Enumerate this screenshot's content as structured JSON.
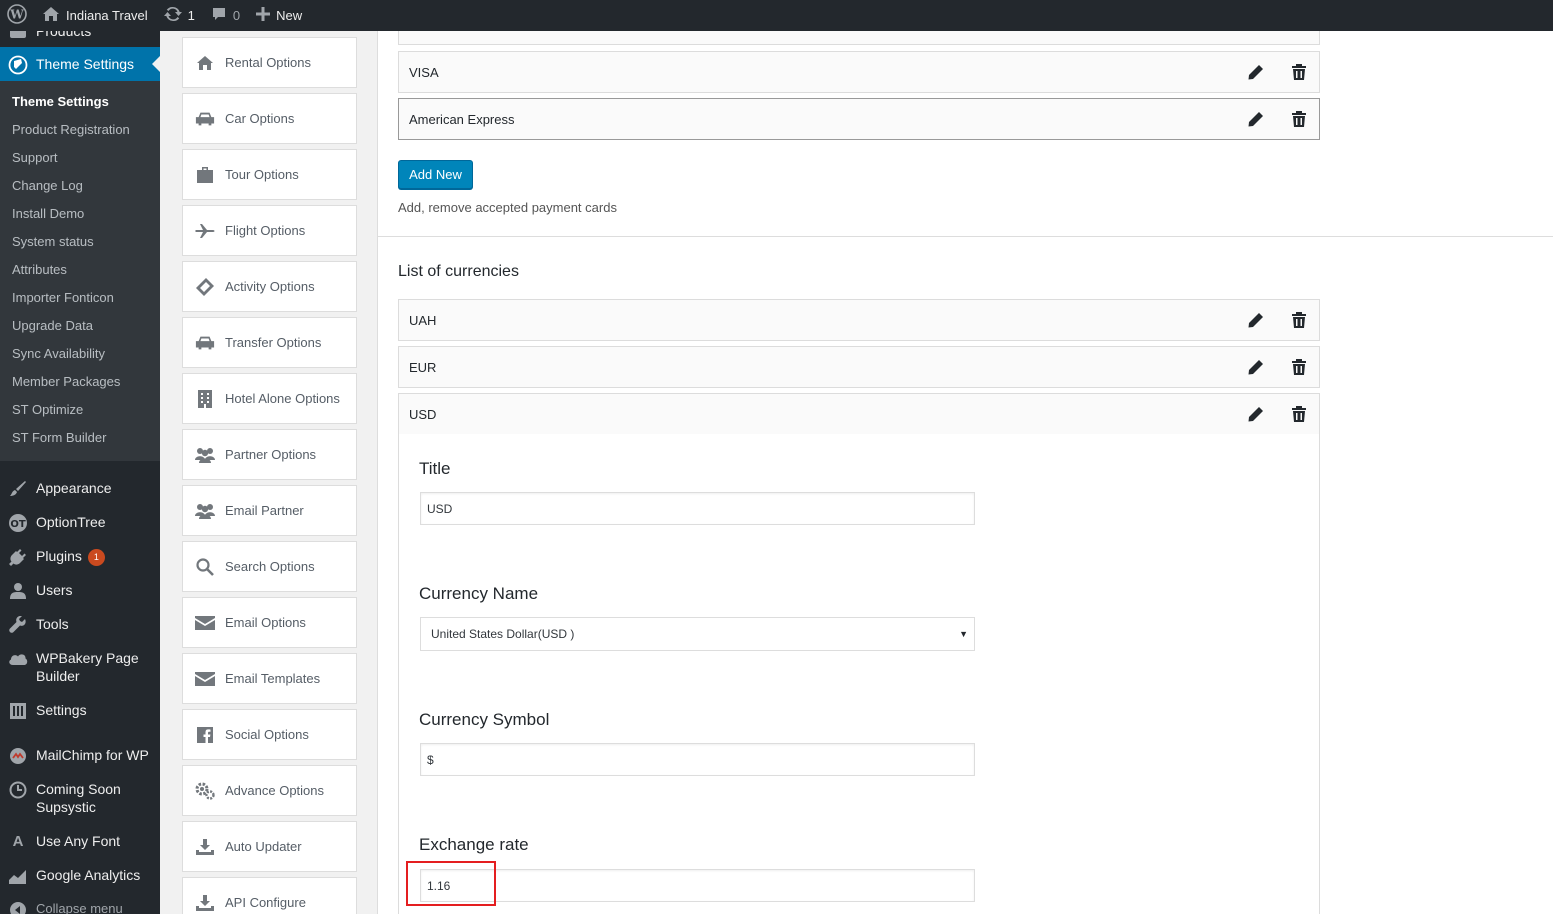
{
  "adminbar": {
    "site_name": "Indiana Travel",
    "updates_count": "1",
    "comments_count": "0",
    "new_label": "New"
  },
  "sidebar": {
    "cut_off_item": "Products",
    "current_menu": "Theme Settings",
    "submenu": [
      "Theme Settings",
      "Product Registration",
      "Support",
      "Change Log",
      "Install Demo",
      "System status",
      "Attributes",
      "Importer Fonticon",
      "Upgrade Data",
      "Sync Availability",
      "Member Packages",
      "ST Optimize",
      "ST Form Builder"
    ],
    "appearance": "Appearance",
    "optiontree": "OptionTree",
    "plugins": "Plugins",
    "plugins_badge": "1",
    "users": "Users",
    "tools": "Tools",
    "wpbakery_line1": "WPBakery Page",
    "wpbakery_line2": "Builder",
    "settings": "Settings",
    "mailchimp": "MailChimp for WP",
    "coming_soon_line1": "Coming Soon",
    "coming_soon_line2": "Supsystic",
    "use_any_font": "Use Any Font",
    "google_analytics": "Google Analytics",
    "collapse": "Collapse menu"
  },
  "option_nav": [
    {
      "label": "Rental Options",
      "icon": "home-icon"
    },
    {
      "label": "Car Options",
      "icon": "car-icon"
    },
    {
      "label": "Tour Options",
      "icon": "suitcase-icon"
    },
    {
      "label": "Flight Options",
      "icon": "plane-icon"
    },
    {
      "label": "Activity Options",
      "icon": "ticket-icon"
    },
    {
      "label": "Transfer Options",
      "icon": "car-icon"
    },
    {
      "label": "Hotel Alone Options",
      "icon": "building-icon"
    },
    {
      "label": "Partner Options",
      "icon": "users-icon"
    },
    {
      "label": "Email Partner",
      "icon": "users-icon"
    },
    {
      "label": "Search Options",
      "icon": "search-icon"
    },
    {
      "label": "Email Options",
      "icon": "envelope-icon"
    },
    {
      "label": "Email Templates",
      "icon": "envelope-icon"
    },
    {
      "label": "Social Options",
      "icon": "facebook-icon"
    },
    {
      "label": "Advance Options",
      "icon": "gears-icon"
    },
    {
      "label": "Auto Updater",
      "icon": "download-icon"
    },
    {
      "label": "API Configure",
      "icon": "download-icon"
    }
  ],
  "payment_cards": {
    "items": [
      "VISA",
      "American Express"
    ],
    "add_new_label": "Add New",
    "description": "Add, remove accepted payment cards"
  },
  "currencies": {
    "section_title": "List of currencies",
    "items": [
      "UAH",
      "EUR",
      "USD"
    ],
    "edit": {
      "title_label": "Title",
      "title_value": "USD",
      "currency_name_label": "Currency Name",
      "currency_name_value": "United States Dollar(USD )",
      "currency_symbol_label": "Currency Symbol",
      "currency_symbol_value": "$",
      "exchange_rate_label": "Exchange rate",
      "exchange_rate_value": "1.16"
    }
  },
  "colors": {
    "admin_dark": "#23282d",
    "submenu_bg": "#32373c",
    "accent_blue": "#0073aa",
    "button_blue": "#0085ba",
    "badge_red": "#ca4a1f",
    "highlight_red": "#e41e20"
  }
}
